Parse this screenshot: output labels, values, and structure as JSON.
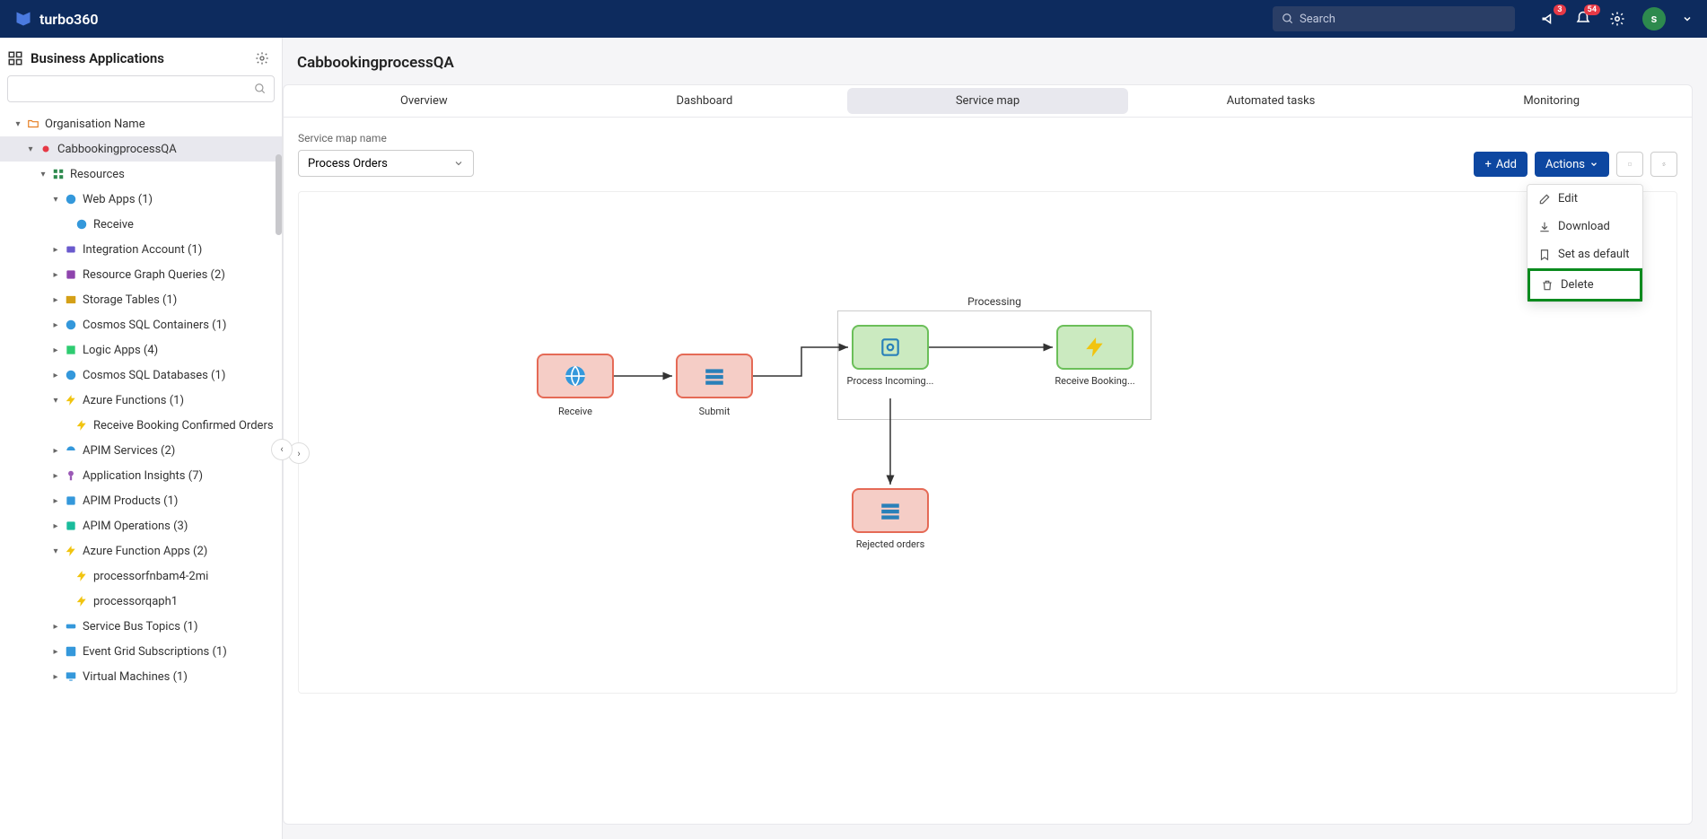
{
  "header": {
    "brand": "turbo360",
    "search_placeholder": "Search",
    "badge1": "3",
    "badge2": "54",
    "avatar_letter": "s"
  },
  "sidebar": {
    "title": "Business Applications",
    "org": "Organisation Name",
    "selected": "CabbookingprocessQA",
    "nodes": {
      "resources": "Resources",
      "webapps": "Web Apps (1)",
      "receive": "Receive",
      "integration": "Integration Account (1)",
      "rgq": "Resource Graph Queries (2)",
      "storage": "Storage Tables (1)",
      "cosmossql": "Cosmos SQL Containers (1)",
      "logicapps": "Logic Apps (4)",
      "cosmosdb": "Cosmos SQL Databases (1)",
      "azfn": "Azure Functions (1)",
      "rbco": "Receive Booking Confirmed Orders",
      "apimsvc": "APIM Services (2)",
      "appins": "Application Insights (7)",
      "apimprod": "APIM Products (1)",
      "apimops": "APIM Operations (3)",
      "azfnapps": "Azure Function Apps (2)",
      "proc1": "processorfnbam4-2mi",
      "proc2": "processorqaph1",
      "sbtopics": "Service Bus Topics (1)",
      "egs": "Event Grid Subscriptions (1)",
      "vms": "Virtual Machines (1)"
    }
  },
  "main": {
    "title": "CabbookingprocessQA",
    "tabs": [
      "Overview",
      "Dashboard",
      "Service map",
      "Automated tasks",
      "Monitoring"
    ],
    "map_label": "Service map name",
    "map_value": "Process Orders",
    "add_btn": "Add",
    "actions_btn": "Actions",
    "dropdown": {
      "edit": "Edit",
      "download": "Download",
      "default": "Set as default",
      "delete": "Delete"
    },
    "diagram": {
      "receive": "Receive",
      "submit": "Submit",
      "processing_group": "Processing",
      "process_incoming": "Process Incoming...",
      "receive_booking": "Receive Booking...",
      "rejected": "Rejected orders"
    }
  }
}
